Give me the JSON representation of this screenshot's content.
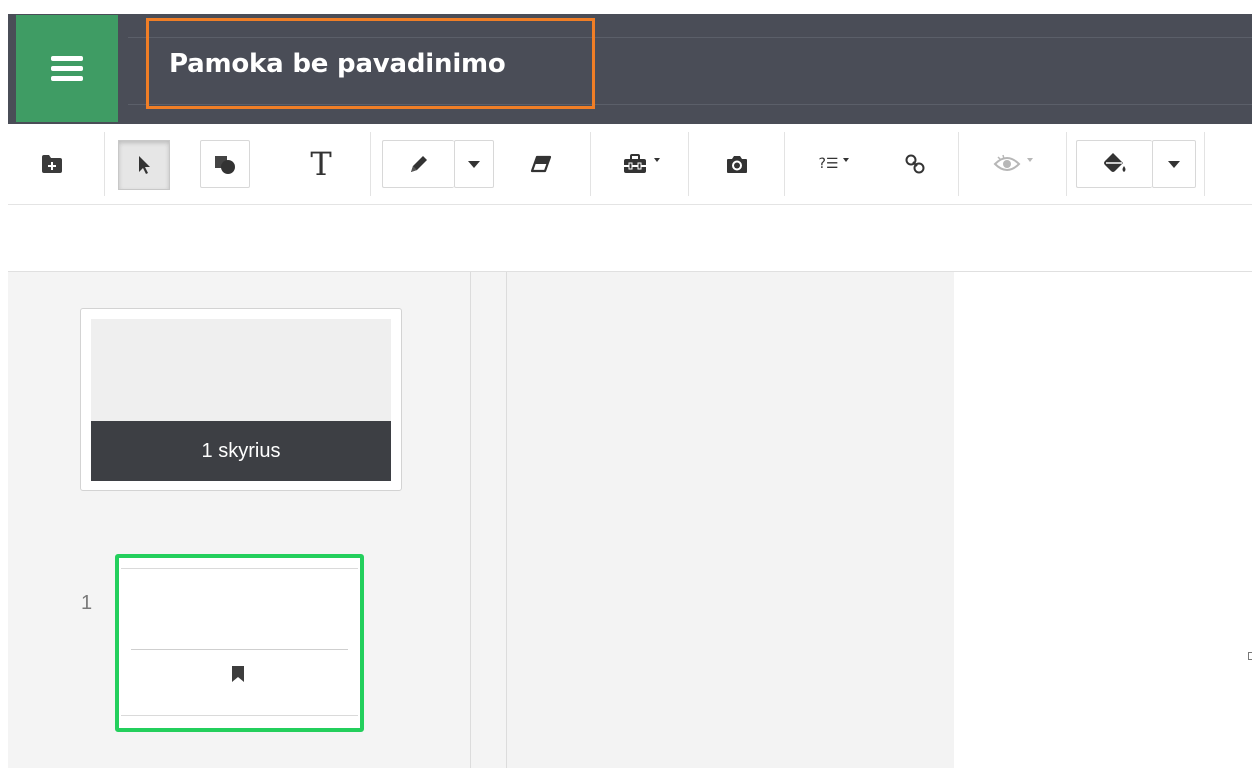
{
  "header": {
    "title": "Pamoka be pavadinimo",
    "menu_icon": "hamburger-icon",
    "menu_color": "#3f9c64",
    "bar_color": "#4a4d57",
    "title_highlight_color": "#f07e26"
  },
  "toolbar": {
    "tools": [
      {
        "name": "add-folder",
        "icon": "folder-plus-icon"
      },
      {
        "name": "select",
        "icon": "cursor-arrow-icon",
        "active": true
      },
      {
        "name": "shapes",
        "icon": "shapes-icon"
      },
      {
        "name": "text",
        "icon": "text-T-icon",
        "label": "T"
      },
      {
        "name": "pen",
        "icon": "pencil-icon"
      },
      {
        "name": "pen-options",
        "icon": "caret-down-icon"
      },
      {
        "name": "eraser",
        "icon": "eraser-icon"
      },
      {
        "name": "toolbox",
        "icon": "toolbox-icon"
      },
      {
        "name": "camera",
        "icon": "camera-icon"
      },
      {
        "name": "question-list",
        "icon": "question-list-icon",
        "label": "?☰"
      },
      {
        "name": "link",
        "icon": "link-icon"
      },
      {
        "name": "reveal",
        "icon": "eye-icon",
        "disabled": true
      },
      {
        "name": "fill",
        "icon": "paint-bucket-icon"
      },
      {
        "name": "fill-options",
        "icon": "caret-down-icon"
      }
    ]
  },
  "sidebar": {
    "section_label": "1 skyrius",
    "page_number": "1",
    "page_icon": "bookmark-icon",
    "selected_page_border": "#23cf5c"
  }
}
